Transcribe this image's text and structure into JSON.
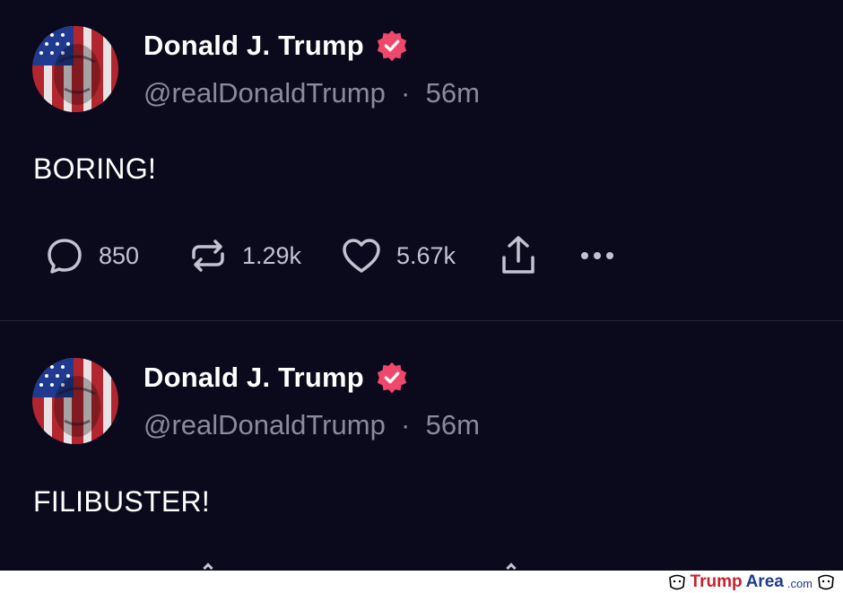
{
  "posts": [
    {
      "author": {
        "display_name": "Donald J. Trump",
        "handle": "@realDonaldTrump",
        "separator": "·",
        "time": "56m",
        "verified": true
      },
      "text": "BORING!",
      "actions": {
        "replies": "850",
        "reposts": "1.29k",
        "likes": "5.67k"
      }
    },
    {
      "author": {
        "display_name": "Donald J. Trump",
        "handle": "@realDonaldTrump",
        "separator": "·",
        "time": "56m",
        "verified": true
      },
      "text": "FILIBUSTER!"
    }
  ],
  "icons": {
    "reply": "speech-bubble-icon",
    "repost": "repost-arrows-icon",
    "like": "heart-icon",
    "share": "share-upload-icon",
    "more": "more-dots-icon",
    "verified": "verified-badge-icon"
  },
  "colors": {
    "background": "#0b0a1c",
    "text": "#ffffff",
    "muted": "#8c8a9a",
    "badge": "#f0476c",
    "icon": "#c4c2d0"
  },
  "watermark": {
    "part1": "Trump",
    "part2": "Area",
    "part3": ".com"
  }
}
